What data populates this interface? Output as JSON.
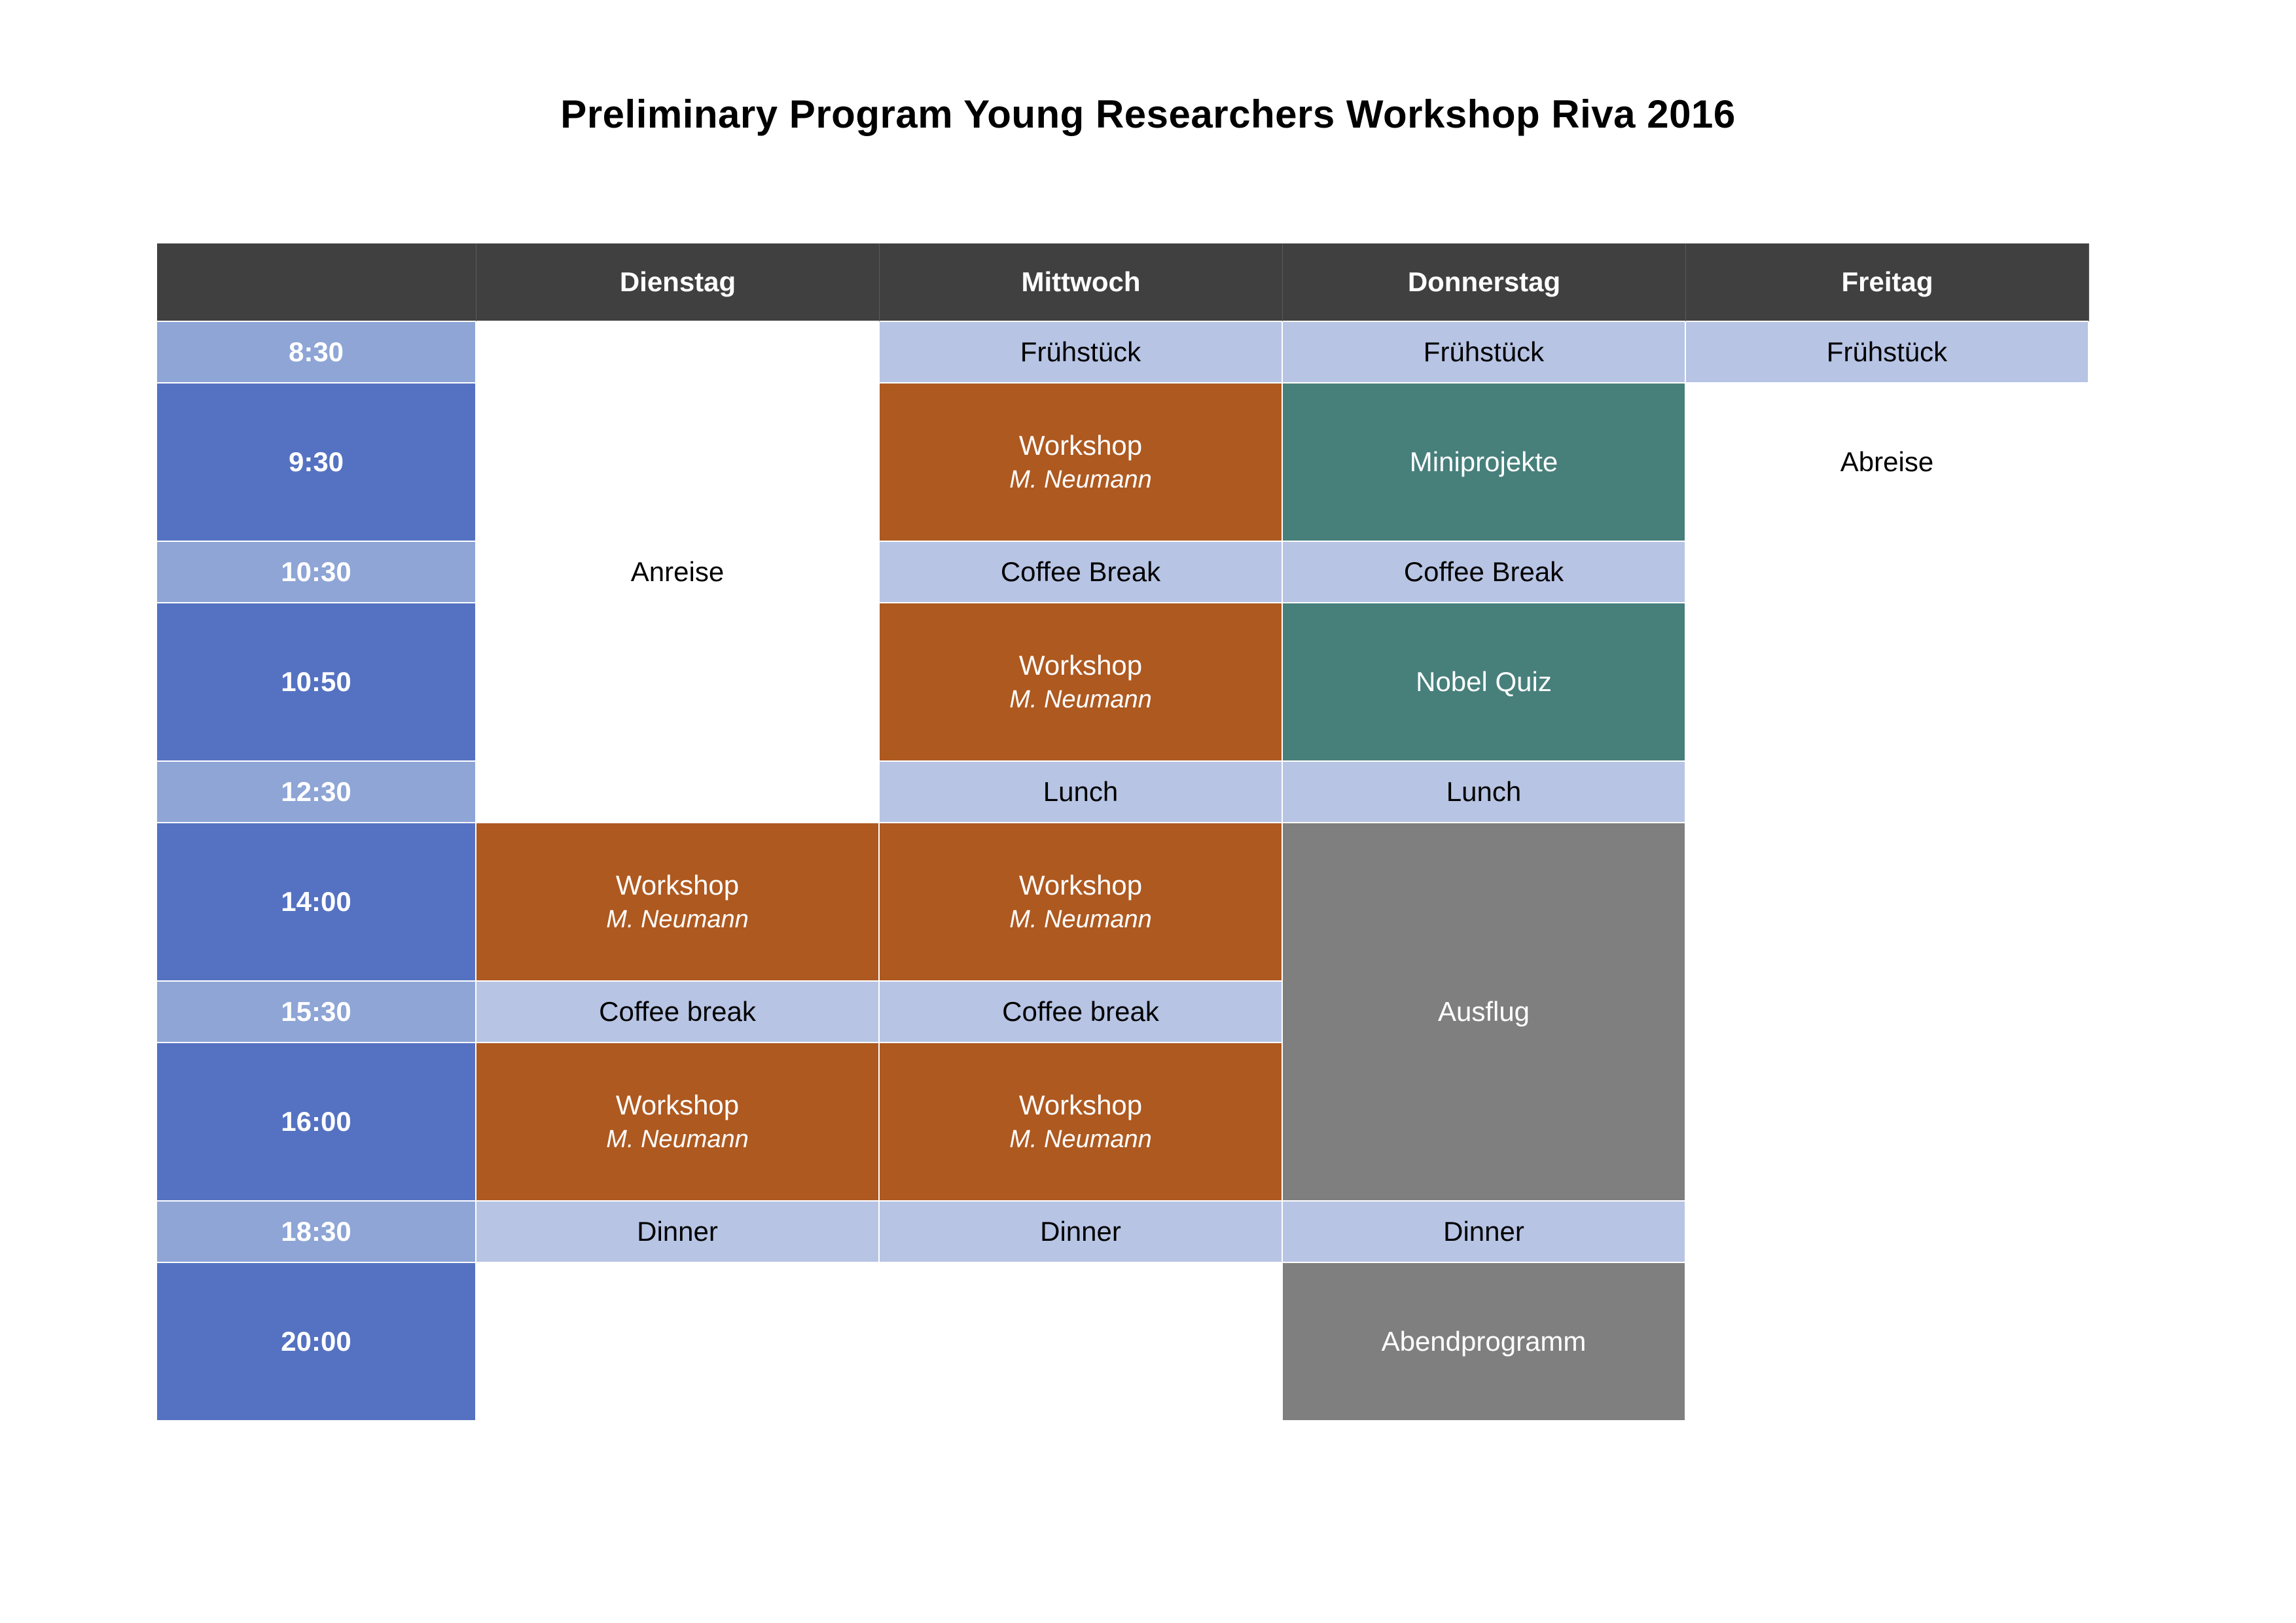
{
  "title": "Preliminary Program Young Researchers Workshop Riva 2016",
  "days": [
    "",
    "Dienstag",
    "Mittwoch",
    "Donnerstag",
    "Freitag"
  ],
  "times": [
    "8:30",
    "9:30",
    "10:30",
    "10:50",
    "12:30",
    "14:00",
    "15:30",
    "16:00",
    "18:30",
    "20:00"
  ],
  "events": {
    "fruehstueck": "Frühstück",
    "workshop": "Workshop",
    "speaker": "M. Neumann",
    "miniprojekte": "Miniprojekte",
    "coffee_break_cap": "Coffee Break",
    "coffee_break_lower": "Coffee break",
    "nobel_quiz": "Nobel Quiz",
    "lunch": "Lunch",
    "ausflug": "Ausflug",
    "dinner": "Dinner",
    "abendprogramm": "Abendprogramm",
    "anreise": "Anreise",
    "abreise": "Abreise"
  },
  "colors": {
    "header": "#404040",
    "time_short": "#8ea5d6",
    "time_long": "#5572c2",
    "light_blue": "#b7c4e4",
    "workshop_orange": "#ae5920",
    "teal": "#477f7b",
    "grey": "#7f7f7f"
  }
}
